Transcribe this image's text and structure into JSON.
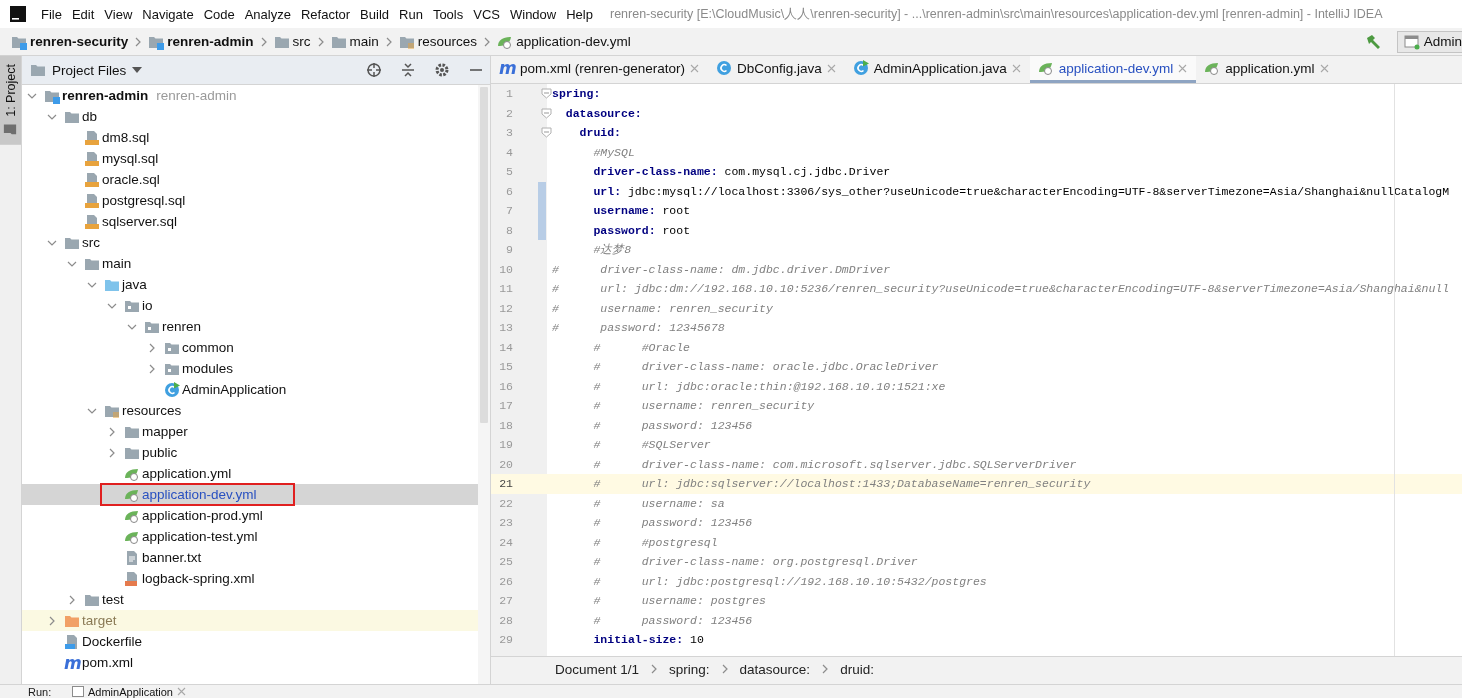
{
  "window": {
    "title": "renren-security [E:\\CloudMusic\\人人\\renren-security] - ...\\renren-admin\\src\\main\\resources\\application-dev.yml [renren-admin] - IntelliJ IDEA"
  },
  "menu": [
    "File",
    "Edit",
    "View",
    "Navigate",
    "Code",
    "Analyze",
    "Refactor",
    "Build",
    "Run",
    "Tools",
    "VCS",
    "Window",
    "Help"
  ],
  "navigation_bar": {
    "crumbs": [
      {
        "label": "renren-security",
        "kind": "module"
      },
      {
        "label": "renren-admin",
        "kind": "module"
      },
      {
        "label": "src",
        "kind": "folder"
      },
      {
        "label": "main",
        "kind": "folder"
      },
      {
        "label": "resources",
        "kind": "resources-root"
      },
      {
        "label": "application-dev.yml",
        "kind": "yml"
      }
    ],
    "run_configuration": "Admin"
  },
  "tool_strip": [
    {
      "label": "1: Project",
      "selected": true
    }
  ],
  "project_panel": {
    "title": "Project Files",
    "tree": [
      {
        "label": "renren-admin",
        "hint": "renren-admin",
        "kind": "module",
        "expanded": true,
        "selected": false,
        "modified": false,
        "boxed": false,
        "children": [
          {
            "label": "db",
            "kind": "folder",
            "expanded": true,
            "selected": false,
            "modified": false,
            "boxed": false,
            "children": [
              {
                "label": "dm8.sql",
                "kind": "sql",
                "selected": false,
                "modified": false,
                "boxed": false
              },
              {
                "label": "mysql.sql",
                "kind": "sql",
                "selected": false,
                "modified": false,
                "boxed": false
              },
              {
                "label": "oracle.sql",
                "kind": "sql",
                "selected": false,
                "modified": false,
                "boxed": false
              },
              {
                "label": "postgresql.sql",
                "kind": "sql",
                "selected": false,
                "modified": false,
                "boxed": false
              },
              {
                "label": "sqlserver.sql",
                "kind": "sql",
                "selected": false,
                "modified": false,
                "boxed": false
              }
            ]
          },
          {
            "label": "src",
            "kind": "folder",
            "expanded": true,
            "selected": false,
            "modified": false,
            "boxed": false,
            "children": [
              {
                "label": "main",
                "kind": "folder",
                "expanded": true,
                "selected": false,
                "modified": false,
                "boxed": false,
                "children": [
                  {
                    "label": "java",
                    "kind": "source-root",
                    "expanded": true,
                    "selected": false,
                    "modified": false,
                    "boxed": false,
                    "children": [
                      {
                        "label": "io",
                        "kind": "package",
                        "expanded": true,
                        "selected": false,
                        "modified": false,
                        "boxed": false,
                        "children": [
                          {
                            "label": "renren",
                            "kind": "package",
                            "expanded": true,
                            "selected": false,
                            "modified": false,
                            "boxed": false,
                            "children": [
                              {
                                "label": "common",
                                "kind": "package",
                                "expanded": false,
                                "selected": false,
                                "modified": false,
                                "boxed": false
                              },
                              {
                                "label": "modules",
                                "kind": "package",
                                "expanded": false,
                                "selected": false,
                                "modified": false,
                                "boxed": false
                              },
                              {
                                "label": "AdminApplication",
                                "kind": "spring-class",
                                "selected": false,
                                "modified": false,
                                "boxed": false
                              }
                            ]
                          }
                        ]
                      }
                    ]
                  },
                  {
                    "label": "resources",
                    "kind": "resources-root",
                    "expanded": true,
                    "selected": false,
                    "modified": false,
                    "boxed": false,
                    "children": [
                      {
                        "label": "mapper",
                        "kind": "folder",
                        "expanded": false,
                        "selected": false,
                        "modified": false,
                        "boxed": false
                      },
                      {
                        "label": "public",
                        "kind": "folder",
                        "expanded": false,
                        "selected": false,
                        "modified": false,
                        "boxed": false
                      },
                      {
                        "label": "application.yml",
                        "kind": "yml",
                        "selected": false,
                        "modified": false,
                        "boxed": false
                      },
                      {
                        "label": "application-dev.yml",
                        "kind": "yml",
                        "selected": true,
                        "modified": true,
                        "boxed": true
                      },
                      {
                        "label": "application-prod.yml",
                        "kind": "yml",
                        "selected": false,
                        "modified": false,
                        "boxed": false
                      },
                      {
                        "label": "application-test.yml",
                        "kind": "yml",
                        "selected": false,
                        "modified": false,
                        "boxed": false
                      },
                      {
                        "label": "banner.txt",
                        "kind": "text",
                        "selected": false,
                        "modified": false,
                        "boxed": false
                      },
                      {
                        "label": "logback-spring.xml",
                        "kind": "xml",
                        "selected": false,
                        "modified": false,
                        "boxed": false
                      }
                    ]
                  }
                ]
              },
              {
                "label": "test",
                "kind": "folder",
                "expanded": false,
                "selected": false,
                "modified": false,
                "boxed": false
              }
            ]
          },
          {
            "label": "target",
            "kind": "excluded",
            "expanded": false,
            "selected": false,
            "modified": false,
            "boxed": false
          },
          {
            "label": "Dockerfile",
            "kind": "docker",
            "selected": false,
            "modified": false,
            "boxed": false
          },
          {
            "label": "pom.xml",
            "kind": "maven",
            "icon_glyph": "m",
            "selected": false,
            "modified": false,
            "boxed": false
          }
        ]
      }
    ]
  },
  "editor": {
    "tabs": [
      {
        "label": "pom.xml (renren-generator)",
        "kind": "maven",
        "icon_glyph": "m",
        "selected": false,
        "modified": false
      },
      {
        "label": "DbConfig.java",
        "kind": "class",
        "selected": false,
        "modified": false
      },
      {
        "label": "AdminApplication.java",
        "kind": "spring-class",
        "selected": false,
        "modified": false
      },
      {
        "label": "application-dev.yml",
        "kind": "yml",
        "selected": true,
        "modified": true
      },
      {
        "label": "application.yml",
        "kind": "yml",
        "selected": false,
        "modified": false
      }
    ],
    "lines": [
      {
        "no": "1",
        "kind": "code",
        "text": "**spring:**",
        "foldable": true,
        "changed": false,
        "current": false
      },
      {
        "no": "2",
        "kind": "code",
        "text": "  **datasource:**",
        "foldable": true,
        "changed": false,
        "current": false
      },
      {
        "no": "3",
        "kind": "code",
        "text": "    **druid:**",
        "foldable": true,
        "changed": false,
        "current": false
      },
      {
        "no": "4",
        "kind": "comment",
        "text": "      #MySQL",
        "foldable": false,
        "changed": false,
        "current": false
      },
      {
        "no": "5",
        "kind": "code",
        "text": "      **driver-class-name:** com.mysql.cj.jdbc.Driver",
        "foldable": false,
        "changed": false,
        "current": false
      },
      {
        "no": "6",
        "kind": "code",
        "text": "      **url:** jdbc:mysql://localhost:3306/sys_other?useUnicode=true&characterEncoding=UTF-8&serverTimezone=Asia/Shanghai&nullCatalogM",
        "foldable": false,
        "changed": true,
        "current": false
      },
      {
        "no": "7",
        "kind": "code",
        "text": "      **username:** root",
        "foldable": false,
        "changed": true,
        "current": false
      },
      {
        "no": "8",
        "kind": "code",
        "text": "      **password:** root",
        "foldable": false,
        "changed": true,
        "current": false
      },
      {
        "no": "9",
        "kind": "comment",
        "text": "      #达梦8",
        "foldable": false,
        "changed": false,
        "current": false
      },
      {
        "no": "10",
        "kind": "comment",
        "text": "#      driver-class-name: dm.jdbc.driver.DmDriver",
        "foldable": false,
        "changed": false,
        "current": false
      },
      {
        "no": "11",
        "kind": "comment",
        "text": "#      url: jdbc:dm://192.168.10.10:5236/renren_security?useUnicode=true&characterEncoding=UTF-8&serverTimezone=Asia/Shanghai&null",
        "foldable": false,
        "changed": false,
        "current": false
      },
      {
        "no": "12",
        "kind": "comment",
        "text": "#      username: renren_security",
        "foldable": false,
        "changed": false,
        "current": false
      },
      {
        "no": "13",
        "kind": "comment",
        "text": "#      password: 12345678",
        "foldable": false,
        "changed": false,
        "current": false
      },
      {
        "no": "14",
        "kind": "comment",
        "text": "      #      #Oracle",
        "foldable": false,
        "changed": false,
        "current": false
      },
      {
        "no": "15",
        "kind": "comment",
        "text": "      #      driver-class-name: oracle.jdbc.OracleDriver",
        "foldable": false,
        "changed": false,
        "current": false
      },
      {
        "no": "16",
        "kind": "comment",
        "text": "      #      url: jdbc:oracle:thin:@192.168.10.10:1521:xe",
        "foldable": false,
        "changed": false,
        "current": false
      },
      {
        "no": "17",
        "kind": "comment",
        "text": "      #      username: renren_security",
        "foldable": false,
        "changed": false,
        "current": false
      },
      {
        "no": "18",
        "kind": "comment",
        "text": "      #      password: 123456",
        "foldable": false,
        "changed": false,
        "current": false
      },
      {
        "no": "19",
        "kind": "comment",
        "text": "      #      #SQLServer",
        "foldable": false,
        "changed": false,
        "current": false
      },
      {
        "no": "20",
        "kind": "comment",
        "text": "      #      driver-class-name: com.microsoft.sqlserver.jdbc.SQLServerDriver",
        "foldable": false,
        "changed": false,
        "current": false
      },
      {
        "no": "21",
        "kind": "comment",
        "text": "      #      url: jdbc:sqlserver://localhost:1433;DatabaseName=renren_security",
        "foldable": false,
        "changed": false,
        "current": true
      },
      {
        "no": "22",
        "kind": "comment",
        "text": "      #      username: sa",
        "foldable": false,
        "changed": false,
        "current": false
      },
      {
        "no": "23",
        "kind": "comment",
        "text": "      #      password: 123456",
        "foldable": false,
        "changed": false,
        "current": false
      },
      {
        "no": "24",
        "kind": "comment",
        "text": "      #      #postgresql",
        "foldable": false,
        "changed": false,
        "current": false
      },
      {
        "no": "25",
        "kind": "comment",
        "text": "      #      driver-class-name: org.postgresql.Driver",
        "foldable": false,
        "changed": false,
        "current": false
      },
      {
        "no": "26",
        "kind": "comment",
        "text": "      #      url: jdbc:postgresql://192.168.10.10:5432/postgres",
        "foldable": false,
        "changed": false,
        "current": false
      },
      {
        "no": "27",
        "kind": "comment",
        "text": "      #      username: postgres",
        "foldable": false,
        "changed": false,
        "current": false
      },
      {
        "no": "28",
        "kind": "comment",
        "text": "      #      password: 123456",
        "foldable": false,
        "changed": false,
        "current": false
      },
      {
        "no": "29",
        "kind": "code",
        "text": "      **initial-size:** 10",
        "foldable": false,
        "changed": false,
        "current": false
      }
    ],
    "breadcrumbs": [
      "Document 1/1",
      "spring:",
      "datasource:",
      "druid:"
    ]
  },
  "run_bar": {
    "label": "Run:",
    "tab": "AdminApplication"
  }
}
